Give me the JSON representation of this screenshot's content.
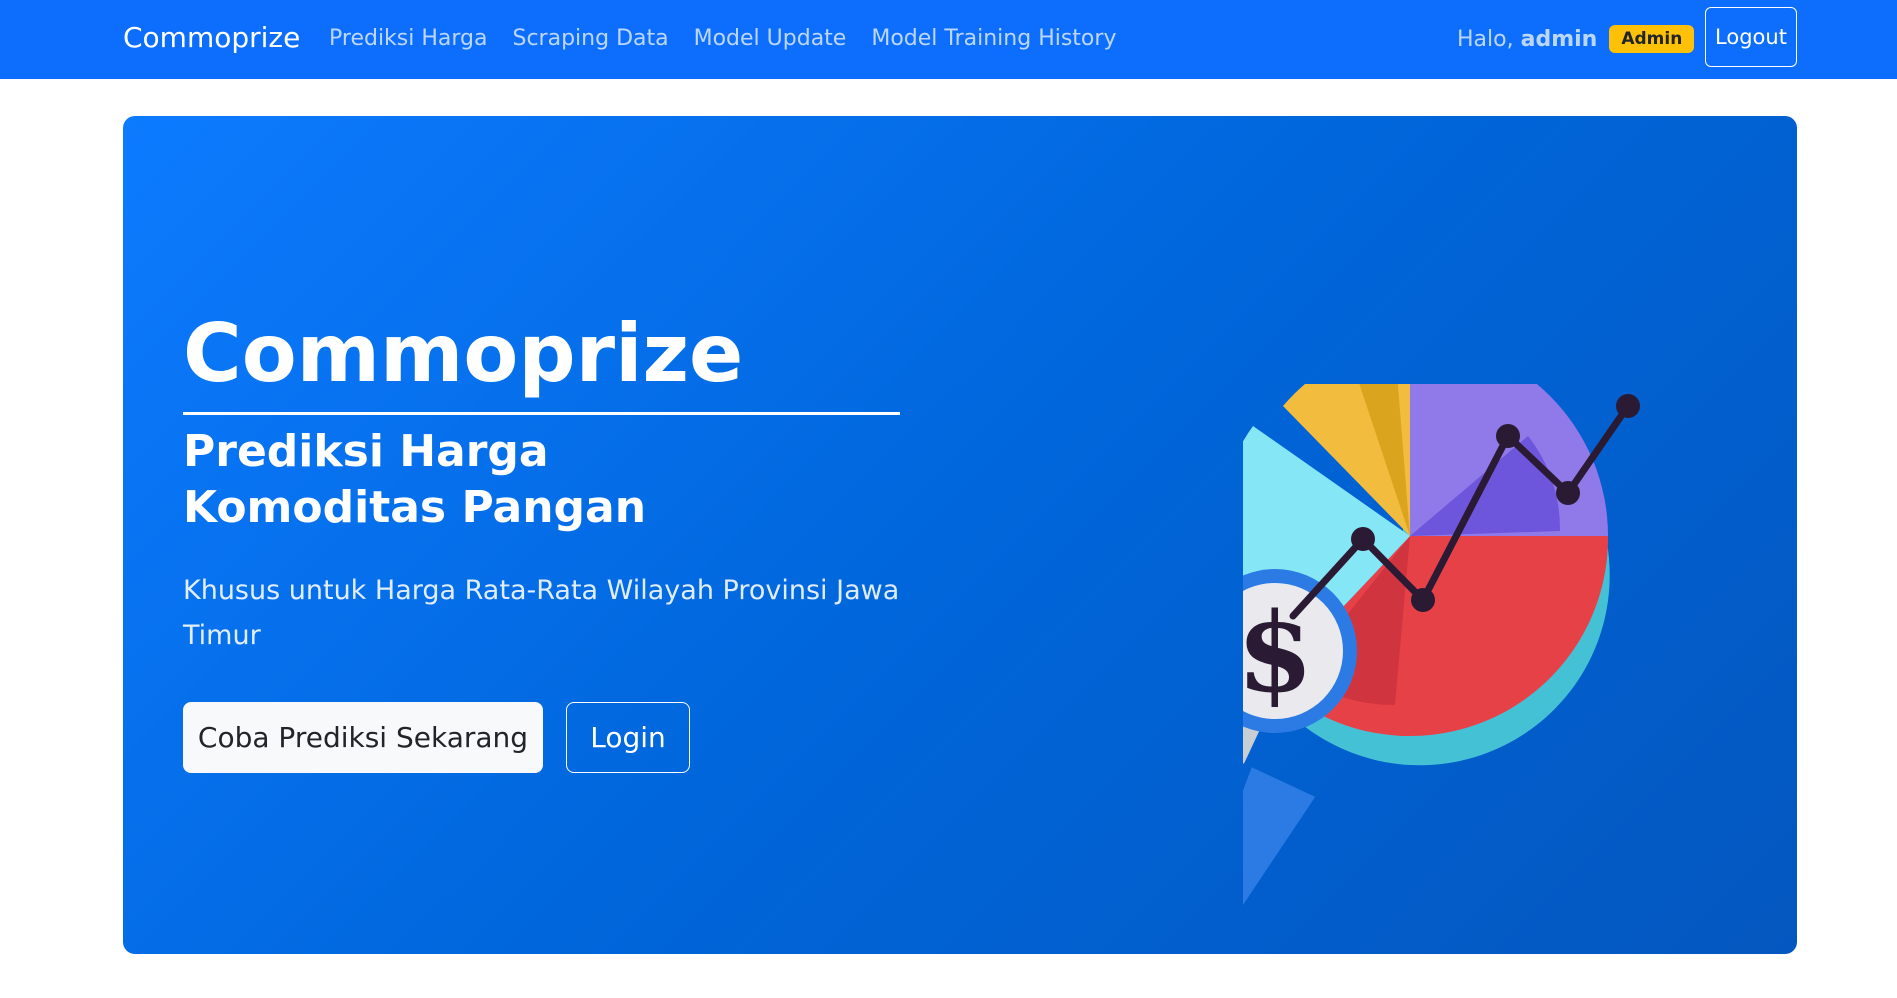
{
  "nav": {
    "brand": "Commoprize",
    "links": [
      "Prediksi Harga",
      "Scraping Data",
      "Model Update",
      "Model Training History"
    ],
    "greeting": "Halo,",
    "username": "admin",
    "role_badge": "Admin",
    "logout_label": "Logout"
  },
  "hero": {
    "title": "Commoprize",
    "subtitle": "Prediksi Harga Komoditas Pangan",
    "description": "Khusus untuk Harga Rata-Rata Wilayah Provinsi Jawa Timur",
    "primary_button": "Coba Prediksi Sekarang",
    "secondary_button": "Login",
    "illustration_icon": "pie-chart-magnifier-dollar-illustration",
    "dollar_symbol": "$"
  },
  "colors": {
    "navbar": "#0d6efd",
    "hero_gradient_start": "#0d7bff",
    "hero_gradient_end": "#0457bf",
    "badge": "#ffc107",
    "pie_purple": "#9079e8",
    "pie_red": "#e74148",
    "pie_yellow": "#f2bd3e",
    "pie_cyan": "#85e6f5",
    "pie_ring": "#45c1d6"
  }
}
